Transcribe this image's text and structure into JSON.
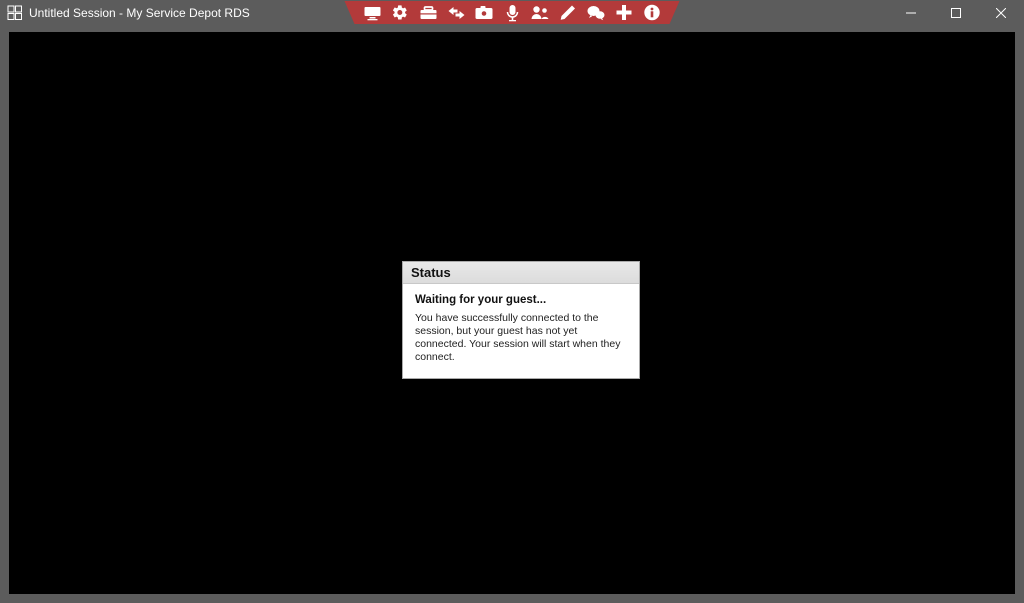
{
  "window": {
    "title": "Untitled Session - My Service Depot RDS"
  },
  "toolbar": {
    "icons": {
      "monitor": "monitor-icon",
      "gear": "gear-icon",
      "toolbox": "toolbox-icon",
      "transfer": "transfer-icon",
      "camera": "camera-icon",
      "microphone": "microphone-icon",
      "participants": "participants-icon",
      "pen": "pen-icon",
      "chat": "chat-icon",
      "plus": "plus-icon",
      "info": "info-icon"
    }
  },
  "status": {
    "title": "Status",
    "heading": "Waiting for your guest...",
    "message": "You have successfully connected to the session, but your guest has not yet connected. Your session will start when they connect."
  }
}
